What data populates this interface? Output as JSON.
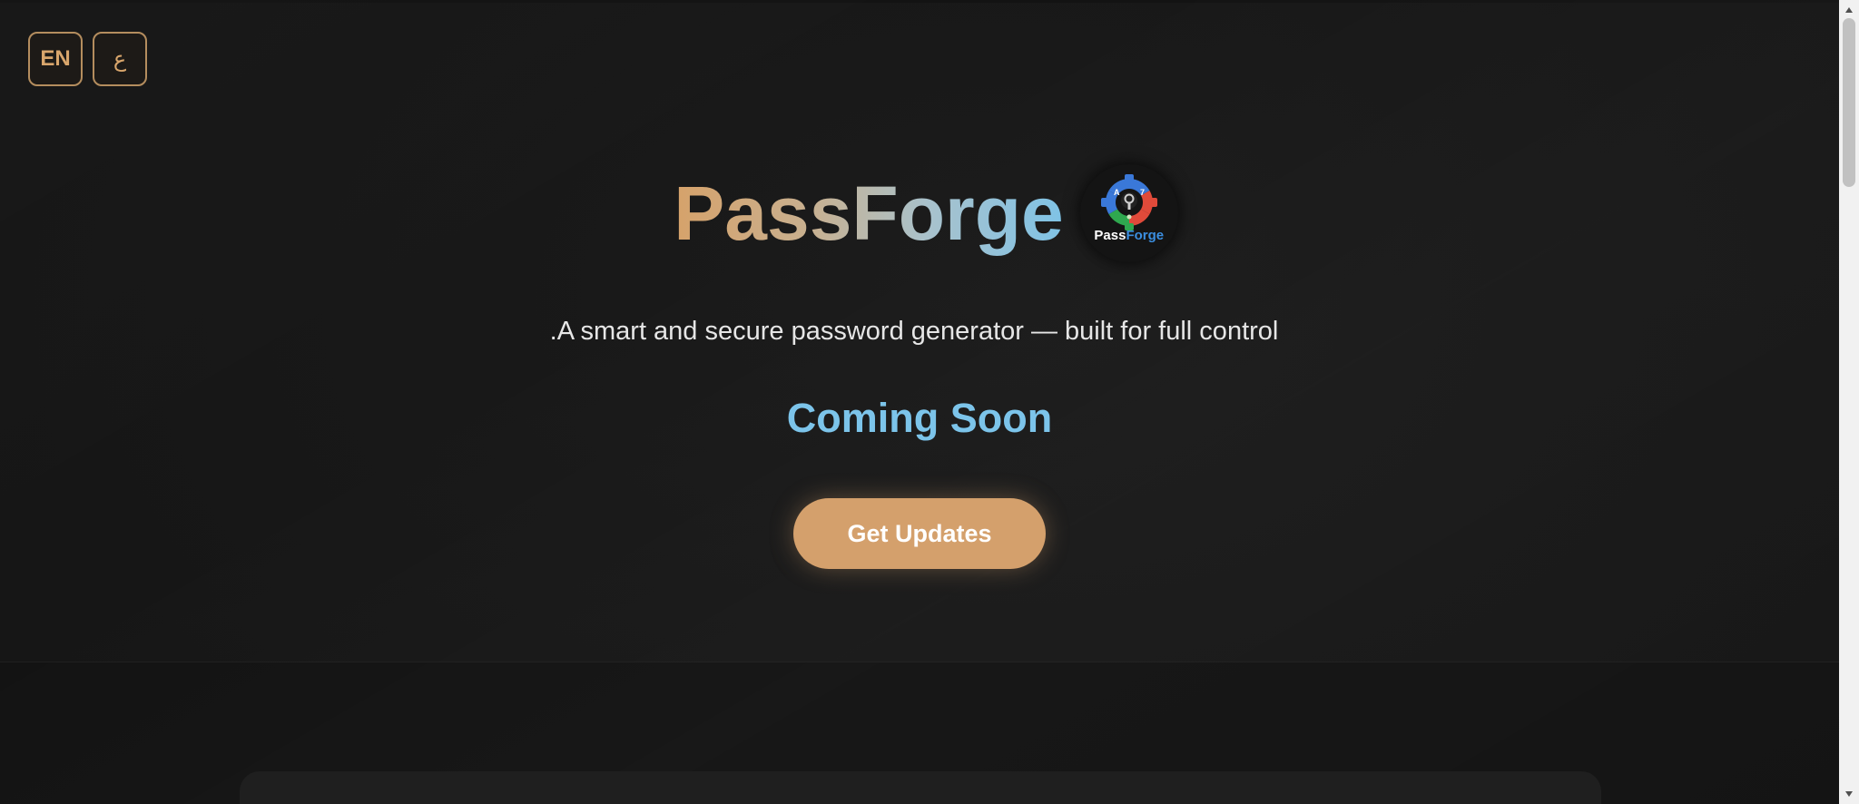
{
  "lang_switch": {
    "en_label": "EN",
    "ar_label": "ع"
  },
  "hero": {
    "title": "PassForge",
    "logo_text_pass": "Pass",
    "logo_text_forge": "Forge",
    "tagline": ".A smart and secure password generator — built for full control",
    "status": "Coming Soon",
    "cta_label": "Get Updates"
  },
  "colors": {
    "background": "#131313",
    "accent_gold": "#d4a06c",
    "accent_blue": "#7cc4ea",
    "text": "#e6e6e6"
  },
  "icons": {
    "logo": "passforge-gear-lock-icon",
    "scroll_up": "triangle-up-icon",
    "scroll_down": "triangle-down-icon"
  }
}
